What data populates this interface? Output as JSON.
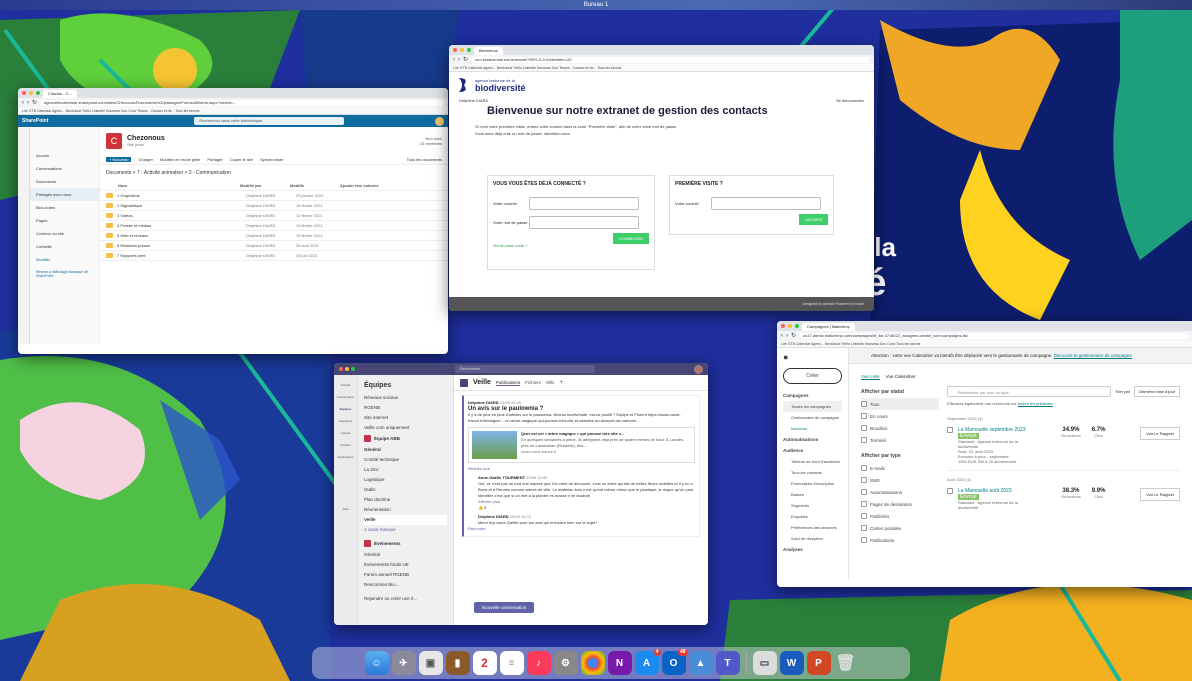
{
  "desktop": {
    "space_name": "Bureau 1",
    "wallpaper_word_1": "e de la",
    "wallpaper_word_2": "ité"
  },
  "sharepoint": {
    "tab_label": "Clioziou - C...",
    "url": "agencebiodiversite.sharepoint.com/sites/CHezonou/Documents%20partages/Forms/AllItems.aspx?viewid=...",
    "bookmarks": "Lire  GTB  Calendar Agenc...  Nextcloud  Trello  LinkedIn  Nouveau  Doc  Conv  Teams - Canaux et de...  Tous les favoris",
    "app_name": "SharePoint",
    "search_placeholder": "Rechercher dans cette bibliothèque",
    "site_initial": "C",
    "site_name": "Chezonous",
    "site_sub": "Site privé",
    "not_followed": "Non suivi",
    "members": "15 membres",
    "nav": [
      "Accueil",
      "Conversations",
      "Documents",
      "Partagés avec nous",
      "Bloc-notes",
      "Pages",
      "Contenu du site",
      "Corbeille",
      "Modifier"
    ],
    "nav_footer": "Revenir à l'affichage classique de SharePoint",
    "cmd": [
      "+ Nouveau",
      "Charger",
      "Modifier en mode grille",
      "Partager",
      "Copier le lien",
      "Synchroniser",
      "Tous les documents"
    ],
    "breadcrumb": "Documents > 7 - Activité animation > 2 - Communication",
    "columns": [
      "Nom",
      "Modifié par",
      "Modifié",
      "Ajouter une colonne"
    ],
    "files": [
      {
        "name": "1 Graphisme",
        "by": "Delphine DIARD",
        "date": "25 janvier 2021"
      },
      {
        "name": "2 Signalétique",
        "by": "Delphine DIARD",
        "date": "18 février 2021"
      },
      {
        "name": "3 Vidéos",
        "by": "Delphine DIARD",
        "date": "12 février 2021"
      },
      {
        "name": "4 Presse et médias",
        "by": "Delphine DIARD",
        "date": "10 février 2021"
      },
      {
        "name": "5 Web et réseaux",
        "by": "Delphine DIARD",
        "date": "15 février 2021"
      },
      {
        "name": "6 Relations presse",
        "by": "Delphine DIARD",
        "date": "28 avril 2021"
      },
      {
        "name": "7 Rapports print",
        "by": "Delphine DIARD",
        "date": "28 juin 2021"
      }
    ]
  },
  "extranet": {
    "tab_label": "Bienvenue",
    "url": "crm.biodiversite.bzh/extranet/?RES-0-0-0/Identifier=20",
    "bookmarks": "Lire  GTB  Calendar Agenc...  Nextcloud  Trello  LinkedIn  Nouveau  Doc  Teams - Canaux et de...  Tous les favoris",
    "logo_line1": "agence bretonne de la",
    "logo_line2": "biodiversité",
    "user_name": "Delphine DIARD",
    "logout": "Se déconnecter",
    "title": "Bienvenue sur notre extranet de gestion des contacts",
    "intro1": "Si c'est votre première visite, entrez votre courriel dans la zone \"Première visite\", afin de créer votre mot de passe.",
    "intro2": "Vous avez déjà créé un mot de passe, identifiez-vous.",
    "login_heading": "VOUS VOUS ÊTES DÉJÀ CONNECTÉ ?",
    "email_label": "Votre courriel",
    "password_label": "Votre mot de passe",
    "connect_button": "CONNEXION",
    "forgot": "Mot de passe oublié ?",
    "first_heading": "PREMIÈRE VISITE ?",
    "first_email_label": "Votre courriel",
    "validate_button": "VALIDER",
    "footer": "Designed by Abebati     Powered by Iroute"
  },
  "teams": {
    "search_placeholder": "Rechercher",
    "team_heading": "Équipes",
    "rail": [
      "Activité",
      "Conversation",
      "Équipes",
      "Calendrier",
      "Appels",
      "Fichiers",
      "Applications",
      "Aide"
    ],
    "channels_top": [
      "Réseaux sociaux",
      "RGENB",
      "Site internet",
      "Veille com uniquement"
    ],
    "team_name": "Équipe ABB",
    "channels": [
      "Général",
      "Comité technique",
      "La Zinc",
      "Logistique",
      "Outils",
      "Plan doctrine",
      "Réorientation",
      "Veille",
      "1 canal masqué"
    ],
    "team2_name": "Événements",
    "team2_channels": [
      "Général",
      "Événements fonds UE",
      "Forum annuel RGENB",
      "Rencontres Bio..."
    ],
    "join_team": "Rejoindre ou créer une é...",
    "channel_title": "Veille",
    "channel_tabs": [
      "Publications",
      "Fichiers",
      "Wiki"
    ],
    "post_author": "Delphine DIARD",
    "post_time": "23/06 10:39",
    "post_title": "Un avis sur le paulownia ?",
    "post_body": "Il y a de plus en plus d'articles sur le paulownia. Niveau biodiversité, est-ce positif ? Equipe et Florent https://www.ouest-france.fr/bretagne/... un-arbre-magique-qui-pousse-très-vite-et-absorbe-du-dioxyde-de-carbone...",
    "card_title": "Quel est cet « arbre magique » qui pousse très vite e...",
    "card_text": "En quelques semaines à peine, ils atteignent déjà près de quatre mètres de haut. À Landes, près de Landivisiau (Finistère), des...",
    "card_site": "www.ouest-france.fr",
    "reduce": "Réduire tout",
    "reply1_author": "Anne-Gaëlle TOURMENT",
    "reply1_time": "23/06 13:42",
    "reply1_body": "Oui, ce n'est pas du tout une espèce que l'on vient de découvrir, c'est un arbre qui fait de belles fleurs violettes et il y en a Brest et à Rennes comme arbres de ville. Le matériau bois n'est qu'est même mieux que le plastique, le risque qu'on peut identifier c'est que si on met à la planter en masse il ne faudrait",
    "show_more": "Afficher plus",
    "reaction": "👍 4",
    "reply2_author": "Delphine DIARD",
    "reply2_time": "25/06 16:22",
    "reply2_body": "Merci bcp Anne-Gaëlle pour ton avis qui m'éclaire bien sur le sujet !",
    "reply_link": "Répondre",
    "new_conversation": "Nouvelle conversation"
  },
  "mailchimp": {
    "tab_label": "Campagnes | Mailchimp",
    "url": "us17.admin.mailchimp.com/campaigns/#f_list:3718022_assigned-create_sort=campaigns-list",
    "bookmarks": "Lire  GTB  Calendar Agenc...  Nextcloud  Trello  LinkedIn  Nouveau  Doc  Conv  Tous les favoris",
    "create_button": "Créer",
    "nav": [
      "Campagnes",
      "Toutes les campagnes",
      "Gestionnaire de campagne",
      "Nouveau",
      "Automatisations",
      "Audience",
      "Tableau de bord d'audience",
      "Tous les contacts",
      "Formulaires d'inscription",
      "Balises",
      "Segments",
      "Enquêtes",
      "Préférences des abonnés",
      "Suivi de réception",
      "Analyses"
    ],
    "notice": "Attention : votre vue Calendrier va bientôt être déplacée vers le gestionnaire de campagne.",
    "notice_link": "Découvrir le gestionnaire de campagne",
    "view_tabs": [
      "Vue Liste",
      "Vue Calendrier"
    ],
    "filter_status_heading": "Afficher par statut",
    "statuses": [
      "Tous",
      "En cours",
      "Brouillon",
      "Terminé"
    ],
    "filter_type_heading": "Afficher par type",
    "types": [
      "E-mails",
      "SMS",
      "Automatisations",
      "Pages de destination",
      "Publicités",
      "Cartes postales",
      "Publications"
    ],
    "search_placeholder": "Rechercher par nom ou type",
    "sort_label": "Trier par",
    "sort_value": "Dernière mise à jour",
    "search_hint": "Effectuez également une recherche sur",
    "search_hint_link": "toutes les publicités",
    "group1": "Septembre 2023 (1)",
    "c1": {
      "title": "La Manouelle septembre 2023",
      "status": "Envoyé",
      "meta": "Standard · Agence bretonne de la biodiversité",
      "sent": "Sept. 15, août 2023",
      "sent2": "Envoyée à plus... septembre",
      "list": "1894 EUR SW à 25 abonnement",
      "opens": "34.9%",
      "opens_label": "Ouvertures",
      "clicks": "6.7%",
      "clicks_label": "Clics",
      "report": "Voir Le Rapport"
    },
    "group2": "Août 2023 (1)",
    "c2": {
      "title": "La Manouelle août 2023",
      "status": "Envoyé",
      "meta": "Standard · Agence bretonne de la biodiversité",
      "opens": "38.3%",
      "opens_label": "Ouvertures",
      "clicks": "9.9%",
      "clicks_label": "Clics",
      "report": "Voir Le Rapport"
    }
  },
  "dock": {
    "apps": [
      "Finder",
      "Launchpad",
      "Aperçu",
      "Notes",
      "Calendrier",
      "Pense-bête",
      "Musique",
      "Réglages",
      "Chrome",
      "OneNote",
      "App Store",
      "Outlook",
      "Aperçu photo",
      "Teams",
      "Capture",
      "Word",
      "PowerPoint",
      "Corbeille"
    ],
    "calendar_day": "2",
    "app_store_badge": "4",
    "outlook_badge": "48"
  }
}
